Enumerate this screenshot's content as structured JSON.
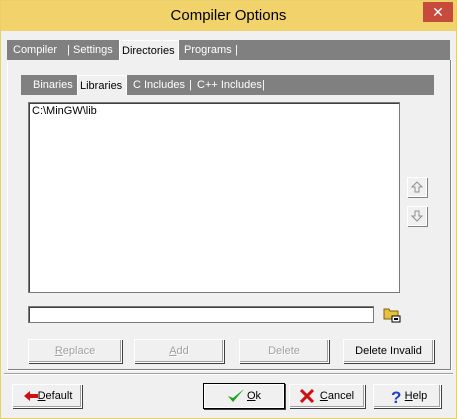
{
  "window": {
    "title": "Compiler Options",
    "close_glyph": "✕"
  },
  "main_tabs": [
    {
      "label": "Compiler"
    },
    {
      "label": "Settings"
    },
    {
      "label": "Directories"
    },
    {
      "label": "Programs"
    }
  ],
  "main_tabs_active": "Directories",
  "sub_tabs": [
    {
      "label": "Binaries"
    },
    {
      "label": "Libraries"
    },
    {
      "label": "C Includes"
    },
    {
      "label": "C++ Includes"
    }
  ],
  "sub_tabs_active": "Libraries",
  "tab_separator": "|",
  "directory_list": {
    "items": [
      "C:\\MinGW\\lib"
    ]
  },
  "path_input": {
    "value": ""
  },
  "action_buttons": {
    "replace": {
      "label": "Replace",
      "accel": "R",
      "rest": "eplace"
    },
    "add": {
      "label": "Add",
      "accel": "A",
      "rest": "dd"
    },
    "delete": {
      "label": "Delete"
    },
    "delete_invalid": {
      "label": "Delete Invalid"
    }
  },
  "footer_buttons": {
    "default": {
      "label": "Default",
      "accel": "D",
      "rest": "efault"
    },
    "ok": {
      "label": "Ok",
      "accel": "O",
      "rest": "k"
    },
    "cancel": {
      "label": "Cancel",
      "accel": "C",
      "rest": "ancel"
    },
    "help": {
      "label": "Help",
      "accel": "H",
      "rest": "elp"
    }
  },
  "colors": {
    "titlebar": "#f2d36b",
    "close": "#c74b3c",
    "ok_check": "#1aa31a",
    "cancel_x": "#d01010",
    "help_q": "#2040c0",
    "default_arrow": "#d01010"
  }
}
